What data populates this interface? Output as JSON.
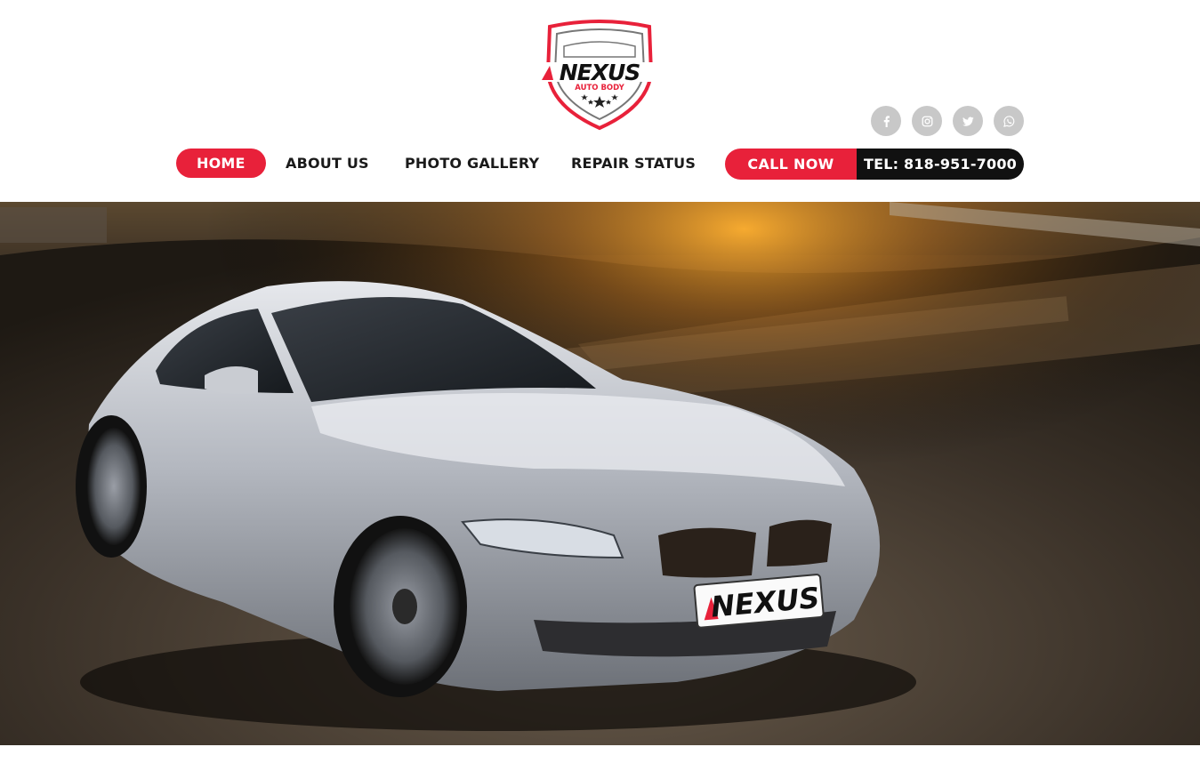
{
  "brand": {
    "name": "NEXUS",
    "tagline": "AUTO BODY",
    "accent_color": "#e8213a",
    "dark_color": "#111111"
  },
  "social": [
    {
      "icon": "facebook-icon"
    },
    {
      "icon": "instagram-icon"
    },
    {
      "icon": "twitter-icon"
    },
    {
      "icon": "whatsapp-icon"
    }
  ],
  "nav": {
    "items": [
      {
        "label": "HOME",
        "active": true
      },
      {
        "label": "ABOUT US",
        "active": false
      },
      {
        "label": "PHOTO GALLERY",
        "active": false
      },
      {
        "label": "REPAIR STATUS",
        "active": false
      }
    ]
  },
  "cta": {
    "call_label": "CALL NOW",
    "tel_label": "TEL: 818-951-7000"
  },
  "hero": {
    "plate_text": "NEXUS"
  }
}
